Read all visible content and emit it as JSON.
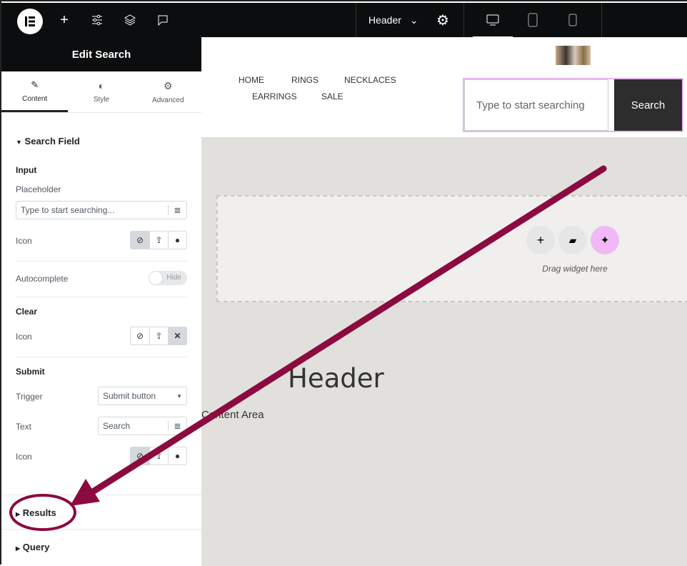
{
  "topbar": {
    "template_name": "Header",
    "icons": [
      "elementor-logo-icon",
      "plus-icon",
      "sliders-icon",
      "layers-icon",
      "comment-icon",
      "chevron-down-icon",
      "gear-icon",
      "desktop-icon",
      "tablet-icon",
      "mobile-icon"
    ]
  },
  "panel": {
    "title": "Edit Search",
    "tabs": [
      {
        "label": "Content"
      },
      {
        "label": "Style"
      },
      {
        "label": "Advanced"
      }
    ],
    "section_search_field": "Search Field",
    "input_heading": "Input",
    "placeholder_label": "Placeholder",
    "placeholder_value": "Type to start searching...",
    "icon_label": "Icon",
    "autocomplete_label": "Autocomplete",
    "autocomplete_toggle": "Hide",
    "clear_heading": "Clear",
    "clear_icon_label": "Icon",
    "submit_heading": "Submit",
    "trigger_label": "Trigger",
    "trigger_value": "Submit button",
    "text_label": "Text",
    "text_value": "Search",
    "submit_icon_label": "Icon",
    "section_results": "Results",
    "section_query": "Query"
  },
  "canvas": {
    "nav": [
      "HOME",
      "RINGS",
      "NECKLACES",
      "EARRINGS",
      "SALE"
    ],
    "search_placeholder": "Type to start searching",
    "search_button": "Search",
    "drop_hint": "Drag widget here",
    "heading": "Header",
    "content_area": "Content Area"
  },
  "colors": {
    "annotation": "#8b0a3f",
    "ai_button": "#f0b9f5",
    "highlight": "#e8b8f0"
  }
}
